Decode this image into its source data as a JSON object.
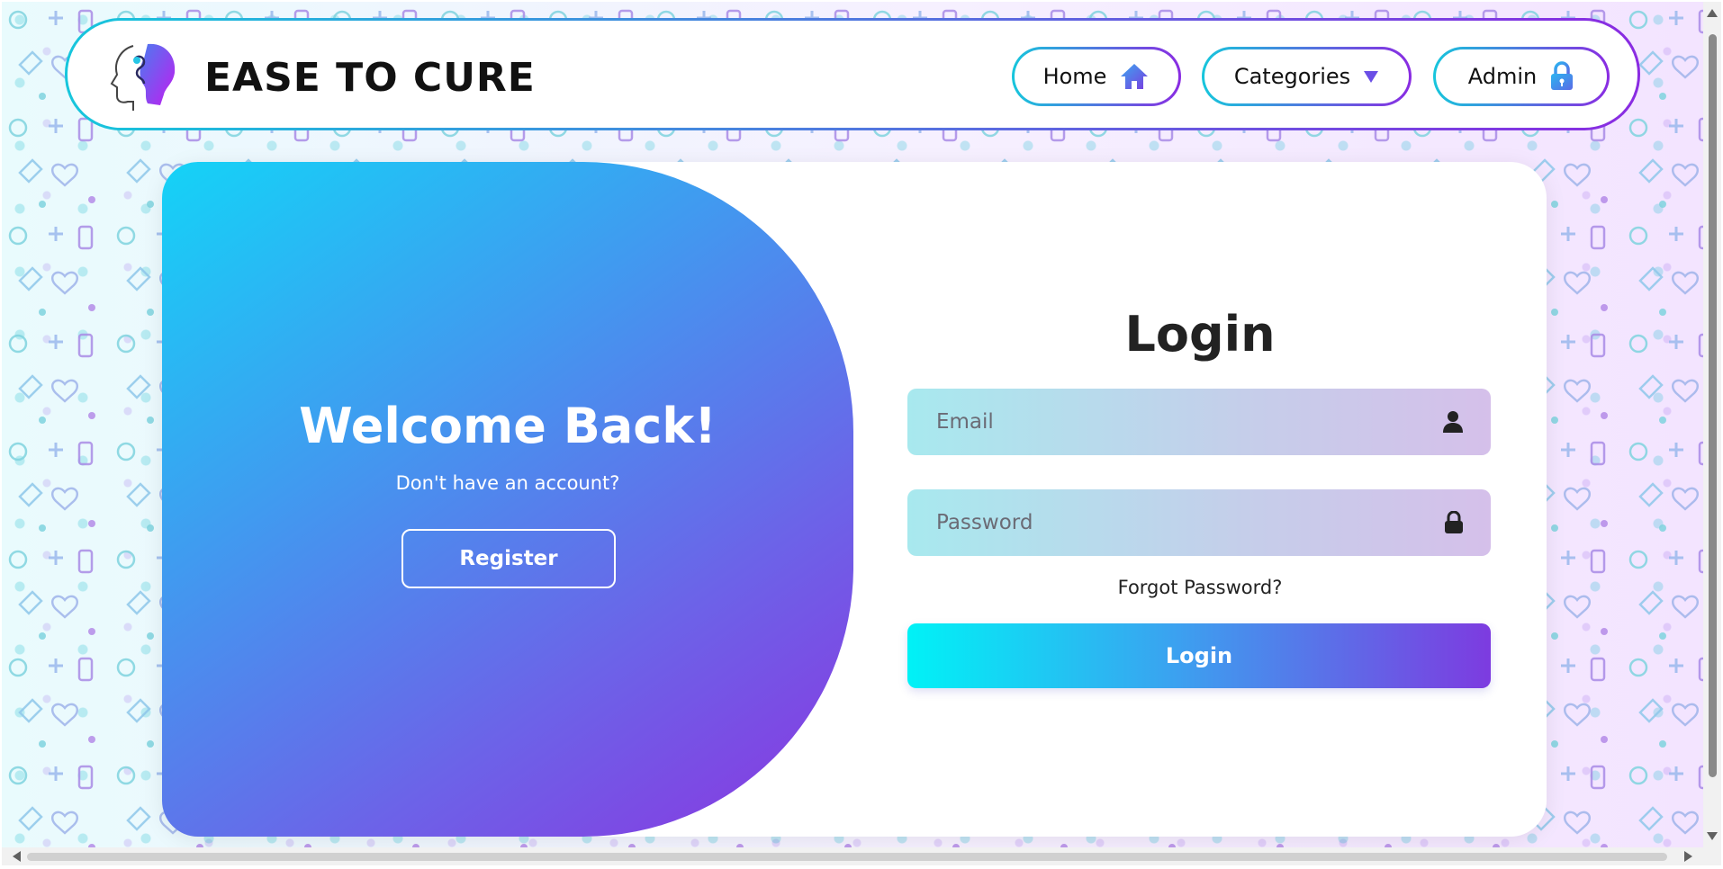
{
  "brand": {
    "name": "EASE TO CURE",
    "logo_icon": "head-brain-logo-icon"
  },
  "nav": {
    "home": {
      "label": "Home",
      "icon": "home-icon"
    },
    "categories": {
      "label": "Categories",
      "icon": "caret-down-icon"
    },
    "admin": {
      "label": "Admin",
      "icon": "lock-icon"
    }
  },
  "welcome": {
    "title": "Welcome Back!",
    "subtitle": "Don't have an account?",
    "register_label": "Register"
  },
  "login": {
    "title": "Login",
    "email_placeholder": "Email",
    "password_placeholder": "Password",
    "forgot_label": "Forgot Password?",
    "submit_label": "Login"
  },
  "colors": {
    "accent_start": "#14d3f7",
    "accent_end": "#8a35e0",
    "text_dark": "#222222"
  }
}
